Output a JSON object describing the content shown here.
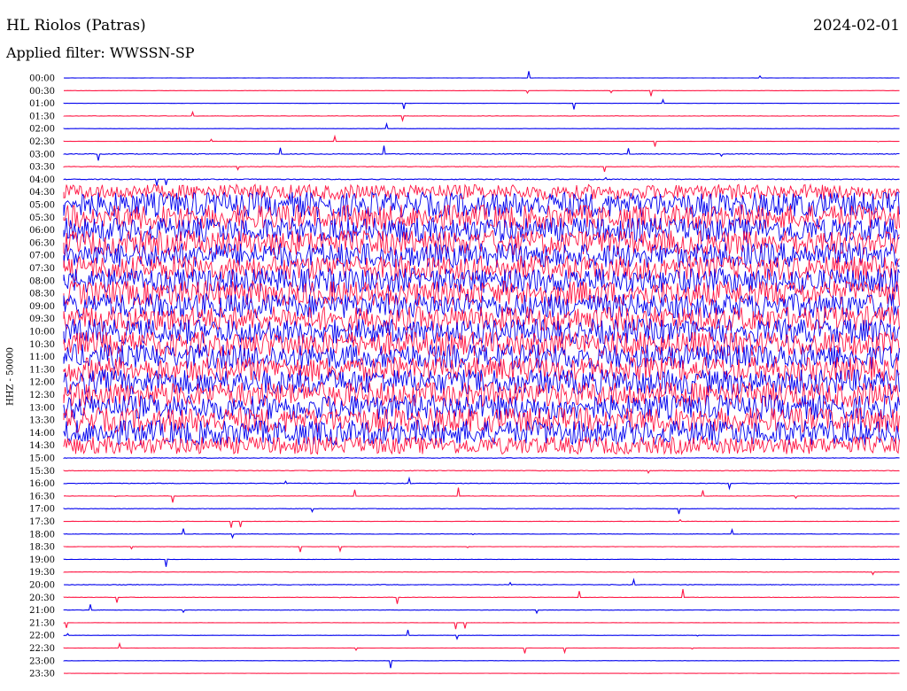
{
  "header": {
    "station": "HL Riolos (Patras)",
    "date": "2024-02-01",
    "filter": "Applied filter: WWSSN-SP",
    "channel_label": "HHZ - 50000"
  },
  "colors": {
    "trace_a": "#0000ee",
    "trace_b": "#ff1744"
  },
  "chart_data": {
    "type": "line",
    "title": "HL Riolos (Patras)",
    "subtitle": "Applied filter: WWSSN-SP",
    "date": "2024-02-01",
    "ylabel": "HHZ - 50000",
    "xlabel": "",
    "grid": false,
    "rows": [
      {
        "time": "00:00",
        "activity": 0.05
      },
      {
        "time": "00:30",
        "activity": 0.05
      },
      {
        "time": "01:00",
        "activity": 0.05
      },
      {
        "time": "01:30",
        "activity": 0.1
      },
      {
        "time": "02:00",
        "activity": 0.05
      },
      {
        "time": "02:30",
        "activity": 0.05
      },
      {
        "time": "03:00",
        "activity": 0.2
      },
      {
        "time": "03:30",
        "activity": 0.15
      },
      {
        "time": "04:00",
        "activity": 0.2
      },
      {
        "time": "04:30",
        "activity": 0.6
      },
      {
        "time": "05:00",
        "activity": 1.0
      },
      {
        "time": "05:30",
        "activity": 1.0
      },
      {
        "time": "06:00",
        "activity": 1.0
      },
      {
        "time": "06:30",
        "activity": 1.0
      },
      {
        "time": "07:00",
        "activity": 1.0
      },
      {
        "time": "07:30",
        "activity": 1.0
      },
      {
        "time": "08:00",
        "activity": 1.0
      },
      {
        "time": "08:30",
        "activity": 1.0
      },
      {
        "time": "09:00",
        "activity": 1.0
      },
      {
        "time": "09:30",
        "activity": 1.0
      },
      {
        "time": "10:00",
        "activity": 1.0
      },
      {
        "time": "10:30",
        "activity": 1.0
      },
      {
        "time": "11:00",
        "activity": 1.0
      },
      {
        "time": "11:30",
        "activity": 1.0
      },
      {
        "time": "12:00",
        "activity": 1.0
      },
      {
        "time": "12:30",
        "activity": 1.0
      },
      {
        "time": "13:00",
        "activity": 1.0
      },
      {
        "time": "13:30",
        "activity": 1.0
      },
      {
        "time": "14:00",
        "activity": 1.0
      },
      {
        "time": "14:30",
        "activity": 0.7
      },
      {
        "time": "15:00",
        "activity": 0.15
      },
      {
        "time": "15:30",
        "activity": 0.15
      },
      {
        "time": "16:00",
        "activity": 0.15
      },
      {
        "time": "16:30",
        "activity": 0.1
      },
      {
        "time": "17:00",
        "activity": 0.1
      },
      {
        "time": "17:30",
        "activity": 0.08
      },
      {
        "time": "18:00",
        "activity": 0.08
      },
      {
        "time": "18:30",
        "activity": 0.08
      },
      {
        "time": "19:00",
        "activity": 0.08
      },
      {
        "time": "19:30",
        "activity": 0.08
      },
      {
        "time": "20:00",
        "activity": 0.15
      },
      {
        "time": "20:30",
        "activity": 0.08
      },
      {
        "time": "21:00",
        "activity": 0.1
      },
      {
        "time": "21:30",
        "activity": 0.05
      },
      {
        "time": "22:00",
        "activity": 0.05
      },
      {
        "time": "22:30",
        "activity": 0.05
      },
      {
        "time": "23:00",
        "activity": 0.05
      },
      {
        "time": "23:30",
        "activity": 0.05
      }
    ]
  }
}
